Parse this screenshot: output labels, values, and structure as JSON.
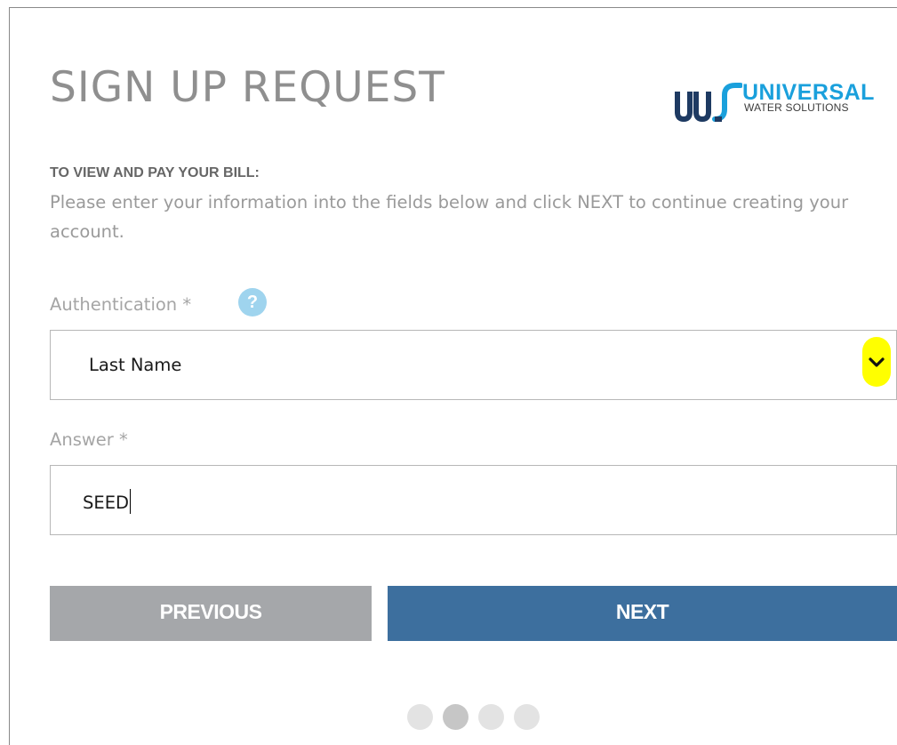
{
  "page": {
    "title": "SIGN UP REQUEST"
  },
  "logo": {
    "name": "UNIVERSAL",
    "tagline": "WATER SOLUTIONS",
    "mark": "UWS"
  },
  "intro": {
    "heading": "TO VIEW AND PAY YOUR BILL:",
    "text": "Please enter your information into the fields below and click NEXT to continue creating your account."
  },
  "form": {
    "authentication": {
      "label": "Authentication *",
      "help_icon": "?",
      "selected": "Last Name"
    },
    "answer": {
      "label": "Answer *",
      "value": "SEED"
    }
  },
  "buttons": {
    "previous": "PREVIOUS",
    "next": "NEXT"
  },
  "progress": {
    "total_steps": 4,
    "current_step": 2
  },
  "colors": {
    "title": "#8f8f8f",
    "brand_blue": "#1aa0dc",
    "next_button": "#3d6f9e",
    "previous_button": "#a5a7aa",
    "highlight": "#ffff00",
    "help_icon": "#9fd4ee"
  },
  "icons": {
    "help": "question-circle-icon",
    "dropdown": "chevron-down-icon"
  }
}
